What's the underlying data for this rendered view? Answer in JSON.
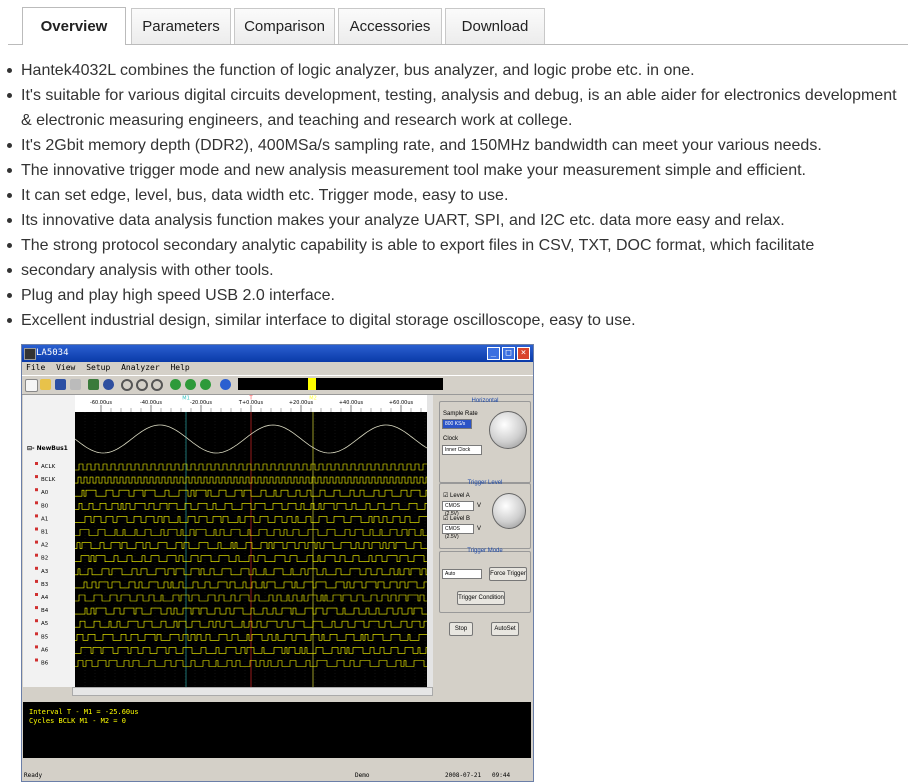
{
  "tabs": [
    {
      "label": "Overview",
      "active": true
    },
    {
      "label": "Parameters",
      "active": false
    },
    {
      "label": "Comparison",
      "active": false
    },
    {
      "label": "Accessories",
      "active": false
    },
    {
      "label": "Download",
      "active": false
    }
  ],
  "features": [
    "Hantek4032L combines the function of logic analyzer, bus analyzer, and logic probe etc. in one.",
    "It's suitable for various digital circuits development, testing, analysis and debug, is an able aider for electronics development & electronic measuring engineers, and teaching and research work at college.",
    "It's 2Gbit memory depth (DDR2), 400MSa/s sampling rate, and 150MHz bandwidth can meet your various needs.",
    "The innovative trigger mode and new analysis measurement tool make your measurement simple and efficient.",
    "It can set edge, level, bus, data width etc. Trigger mode, easy to use.",
    "Its innovative data analysis function makes your analyze UART, SPI, and I2C etc. data more easy and relax.",
    "The strong protocol secondary analytic capability is able to export files in CSV, TXT, DOC format, which facilitate",
    "secondary analysis with other tools.",
    "Plug and play high speed USB 2.0 interface.",
    "Excellent industrial design, similar interface to digital storage oscilloscope, easy to use."
  ],
  "app": {
    "title": "LA5034",
    "menu": [
      "File",
      "View",
      "Setup",
      "Analyzer",
      "Help"
    ],
    "time_ticks": [
      "-60.00us",
      "-40.00us",
      "-20.00us",
      "T+0.00us",
      "+20.00us",
      "+40.00us",
      "+60.00us"
    ],
    "markers": [
      "M1",
      "T",
      "M2"
    ],
    "bus_name": "NewBus1",
    "channels": [
      "ACLK",
      "BCLK",
      "A0",
      "B0",
      "A1",
      "B1",
      "A2",
      "B2",
      "A3",
      "B3",
      "A4",
      "B4",
      "A5",
      "B5",
      "A6",
      "B6"
    ],
    "horizontal": {
      "title": "Horizontal",
      "sample_rate_label": "Sample Rate",
      "sample_rate_value": "800 KS/s",
      "clock_label": "Clock",
      "clock_value": "Inner Clock"
    },
    "trigger_level": {
      "title": "Trigger Level",
      "level_a": "Level A",
      "level_a_value": "CMOS (2.5V)",
      "level_b": "Level B",
      "level_b_value": "CMOS (2.5V)",
      "unit": "V"
    },
    "trigger_mode": {
      "title": "Trigger Mode",
      "mode_value": "Auto",
      "force_trigger": "Force Trigger",
      "trigger_condition": "Trigger Condition"
    },
    "stop_label": "Stop",
    "autoset_label": "AutoSet",
    "status_lines": [
      "Interval T - M1 = -25.60us",
      "Cycles BCLK M1 - M2 = 0"
    ],
    "statusbar": {
      "left": "Ready",
      "mid": "Demo",
      "date": "2008-07-21",
      "time": "09:44"
    }
  }
}
